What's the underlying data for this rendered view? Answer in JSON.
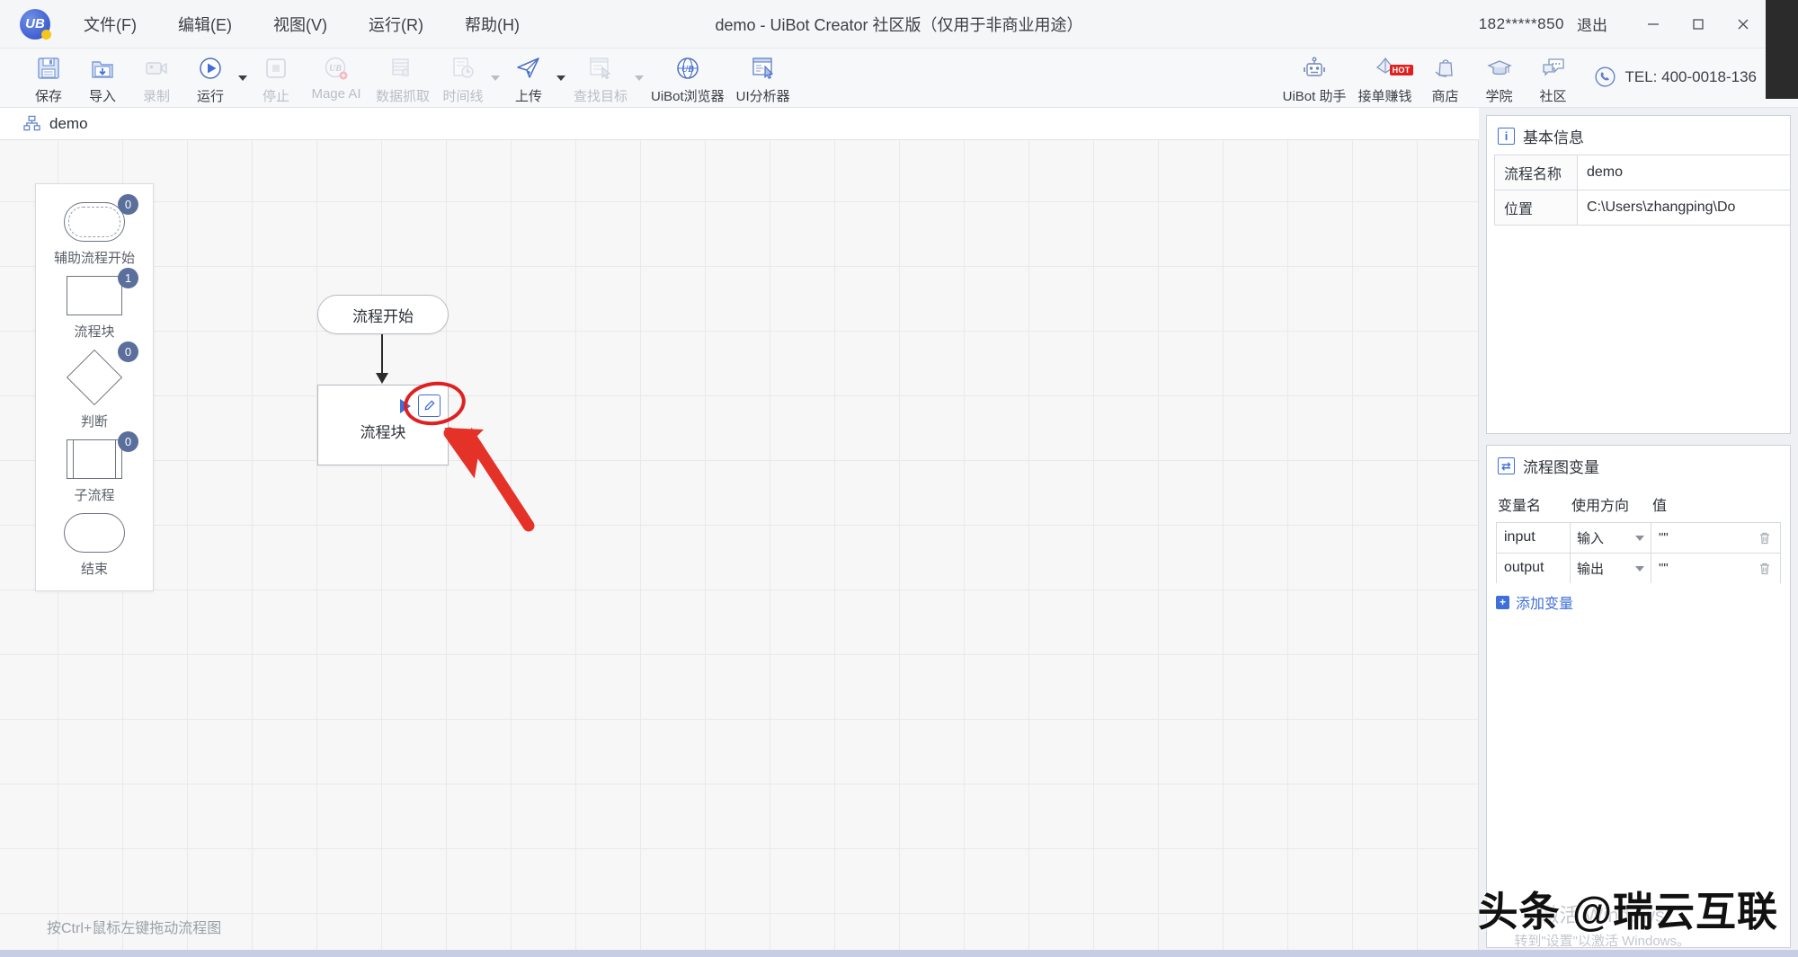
{
  "window": {
    "title": "demo  - UiBot Creator 社区版（仅用于非商业用途）",
    "account": "182*****850",
    "logout": "退出",
    "logo_text": "UB"
  },
  "menubar": {
    "items": [
      {
        "label": "文件(F)",
        "name": "menu-file"
      },
      {
        "label": "编辑(E)",
        "name": "menu-edit"
      },
      {
        "label": "视图(V)",
        "name": "menu-view"
      },
      {
        "label": "运行(R)",
        "name": "menu-run"
      },
      {
        "label": "帮助(H)",
        "name": "menu-help"
      }
    ]
  },
  "toolbar": {
    "left": [
      {
        "label": "保存",
        "icon": "save-icon",
        "disabled": false,
        "dropdown": false
      },
      {
        "label": "导入",
        "icon": "import-icon",
        "disabled": false,
        "dropdown": false
      },
      {
        "label": "录制",
        "icon": "record-icon",
        "disabled": true,
        "dropdown": false
      },
      {
        "label": "运行",
        "icon": "run-icon",
        "disabled": false,
        "dropdown": true
      },
      {
        "label": "停止",
        "icon": "stop-icon",
        "disabled": true,
        "dropdown": false
      },
      {
        "label": "Mage AI",
        "icon": "mage-ai-icon",
        "disabled": true,
        "dropdown": false
      },
      {
        "label": "数据抓取",
        "icon": "data-scrape-icon",
        "disabled": true,
        "dropdown": false
      },
      {
        "label": "时间线",
        "icon": "timeline-icon",
        "disabled": true,
        "dropdown": true
      },
      {
        "label": "上传",
        "icon": "upload-icon",
        "disabled": false,
        "dropdown": true
      },
      {
        "label": "查找目标",
        "icon": "find-target-icon",
        "disabled": true,
        "dropdown": true
      },
      {
        "label": "UiBot浏览器",
        "icon": "uibot-browser-icon",
        "disabled": false,
        "dropdown": false
      },
      {
        "label": "UI分析器",
        "icon": "ui-analyzer-icon",
        "disabled": false,
        "dropdown": false
      }
    ],
    "right": [
      {
        "label": "UiBot 助手",
        "icon": "robot-icon",
        "badge": ""
      },
      {
        "label": "接单赚钱",
        "icon": "earn-money-icon",
        "badge": "HOT"
      },
      {
        "label": "商店",
        "icon": "shop-icon",
        "badge": ""
      },
      {
        "label": "学院",
        "icon": "academy-icon",
        "badge": ""
      },
      {
        "label": "社区",
        "icon": "community-icon",
        "badge": ""
      }
    ],
    "tel": "TEL: 400-0018-136"
  },
  "tabs": [
    {
      "label": "demo",
      "icon": "flowchart-icon",
      "active": true
    }
  ],
  "palette": {
    "items": [
      {
        "label": "辅助流程开始",
        "shape": "start-aux",
        "count": "0"
      },
      {
        "label": "流程块",
        "shape": "rect",
        "count": "1"
      },
      {
        "label": "判断",
        "shape": "diamond",
        "count": "0"
      },
      {
        "label": "子流程",
        "shape": "subprocess",
        "count": "0"
      },
      {
        "label": "结束",
        "shape": "end",
        "count": ""
      }
    ]
  },
  "flow": {
    "start_node": "流程开始",
    "block_node": "流程块",
    "hint": "按Ctrl+鼠标左键拖动流程图"
  },
  "basic_info": {
    "title": "基本信息",
    "rows": [
      {
        "key": "流程名称",
        "value": "demo"
      },
      {
        "key": "位置",
        "value": "C:\\Users\\zhangping\\Do"
      }
    ]
  },
  "variables": {
    "title": "流程图变量",
    "columns": {
      "name": "变量名",
      "direction": "使用方向",
      "value": "值"
    },
    "rows": [
      {
        "name": "input",
        "direction": "输入",
        "value": "\"\""
      },
      {
        "name": "output",
        "direction": "输出",
        "value": "\"\""
      }
    ],
    "add_label": "添加变量"
  },
  "overlay": {
    "activation_line1": "激活 Windows",
    "activation_line2": "转到\"设置\"以激活 Windows。",
    "watermark": "头条 @瑞云互联"
  },
  "colors": {
    "accent": "#3f6fd8",
    "annotation": "#e02020",
    "badge": "#5b6f9c",
    "hot": "#e02020"
  }
}
